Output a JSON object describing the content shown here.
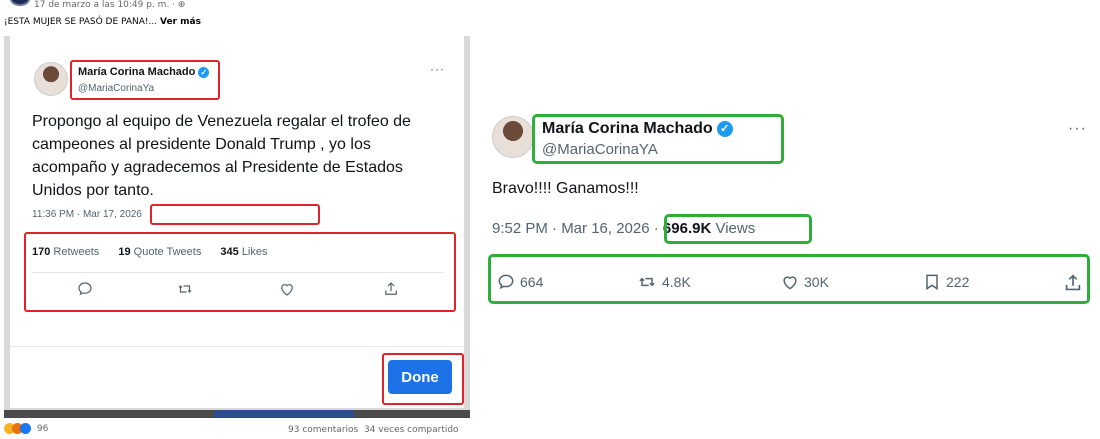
{
  "facebook": {
    "timestamp": "17 de marzo a las 10:49 p. m. · ",
    "caption": "¡ESTA MUJER SE PASÓ DE PANA!... ",
    "see_more": "Ver más",
    "reaction_count": "96",
    "comments": "93 comentarios",
    "shares": "34 veces compartido"
  },
  "left_tweet": {
    "name": "María Corina Machado",
    "handle": "@MariaCorinaYa",
    "more": "···",
    "text": "Propongo al equipo de Venezuela regalar el trofeo de campeones al presidente Donald Trump , yo los acompaño y agradecemos al Presidente de Estados Unidos por tanto.",
    "datetime": "11:36 PM · Mar 17, 2026",
    "retweets_count": "170",
    "retweets_label": "Retweets",
    "quotes_count": "19",
    "quotes_label": "Quote Tweets",
    "likes_count": "345",
    "likes_label": "Likes",
    "done_label": "Done"
  },
  "right_tweet": {
    "name": "María Corina Machado",
    "handle": "@MariaCorinaYA",
    "more": "···",
    "text": "Bravo!!!! Ganamos!!!",
    "time": "9:52 PM · Mar 16, 2026 · ",
    "views_count": "696.9K",
    "views_label": "Views",
    "replies": "664",
    "reposts": "4.8K",
    "likes": "30K",
    "bookmarks": "222"
  },
  "colors": {
    "red_highlight": "#e0242b",
    "green_highlight": "#2fae3a",
    "verified_blue": "#1d9bf0",
    "done_button": "#1d72e8"
  }
}
